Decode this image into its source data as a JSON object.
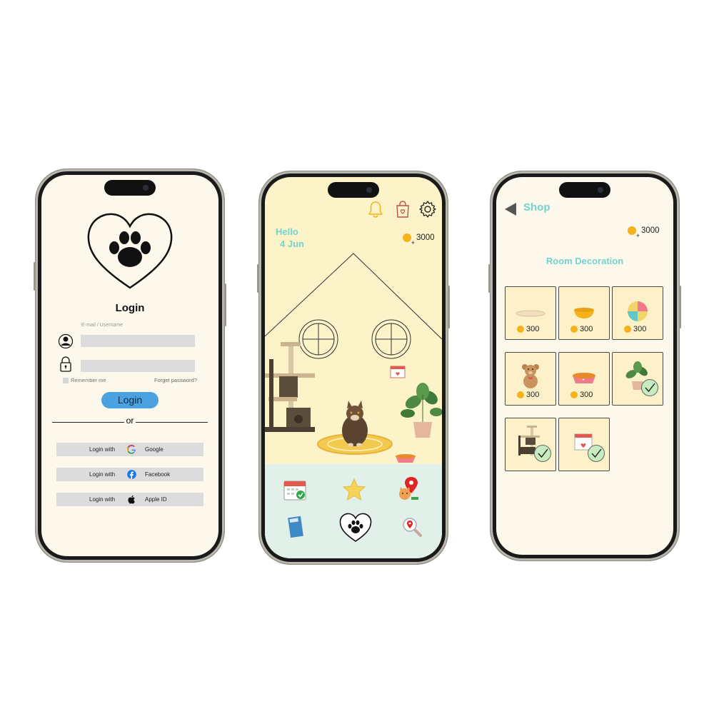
{
  "login": {
    "title": "Login",
    "email_placeholder": "E-mail / Username",
    "remember": "Remember me",
    "forget": "Forget password?",
    "login_button": "Login",
    "or": "or",
    "social": [
      {
        "prefix": "Login with",
        "provider": "Google",
        "icon": "google-icon"
      },
      {
        "prefix": "Login with",
        "provider": "Facebook",
        "icon": "facebook-icon"
      },
      {
        "prefix": "Login with",
        "provider": "Apple ID",
        "icon": "apple-icon"
      }
    ]
  },
  "home": {
    "greeting": "Hello",
    "date": "4 Jun",
    "coins": "3000",
    "top_icons": [
      "bell-icon",
      "shopping-bag-icon",
      "settings-gear-icon"
    ],
    "bottom_icons": [
      "calendar-icon",
      "star-icon",
      "map-pin-icon",
      "journal-icon",
      "paw-heart-icon",
      "search-location-icon"
    ]
  },
  "shop": {
    "title": "Shop",
    "coins": "3000",
    "section": "Room Decoration",
    "items": [
      {
        "name": "rug",
        "price": "300",
        "owned": false
      },
      {
        "name": "bowl",
        "price": "300",
        "owned": false
      },
      {
        "name": "ball",
        "price": "300",
        "owned": false
      },
      {
        "name": "teddy-bear",
        "price": "300",
        "owned": false
      },
      {
        "name": "food-bowl",
        "price": "300",
        "owned": false
      },
      {
        "name": "plant",
        "price": "",
        "owned": true
      },
      {
        "name": "cat-tree",
        "price": "",
        "owned": true
      },
      {
        "name": "calendar",
        "price": "",
        "owned": true
      }
    ]
  },
  "colors": {
    "accent": "#72d3cf",
    "cream": "#fdf8ec",
    "button": "#4aa3e0",
    "coin": "#f5b21b"
  }
}
